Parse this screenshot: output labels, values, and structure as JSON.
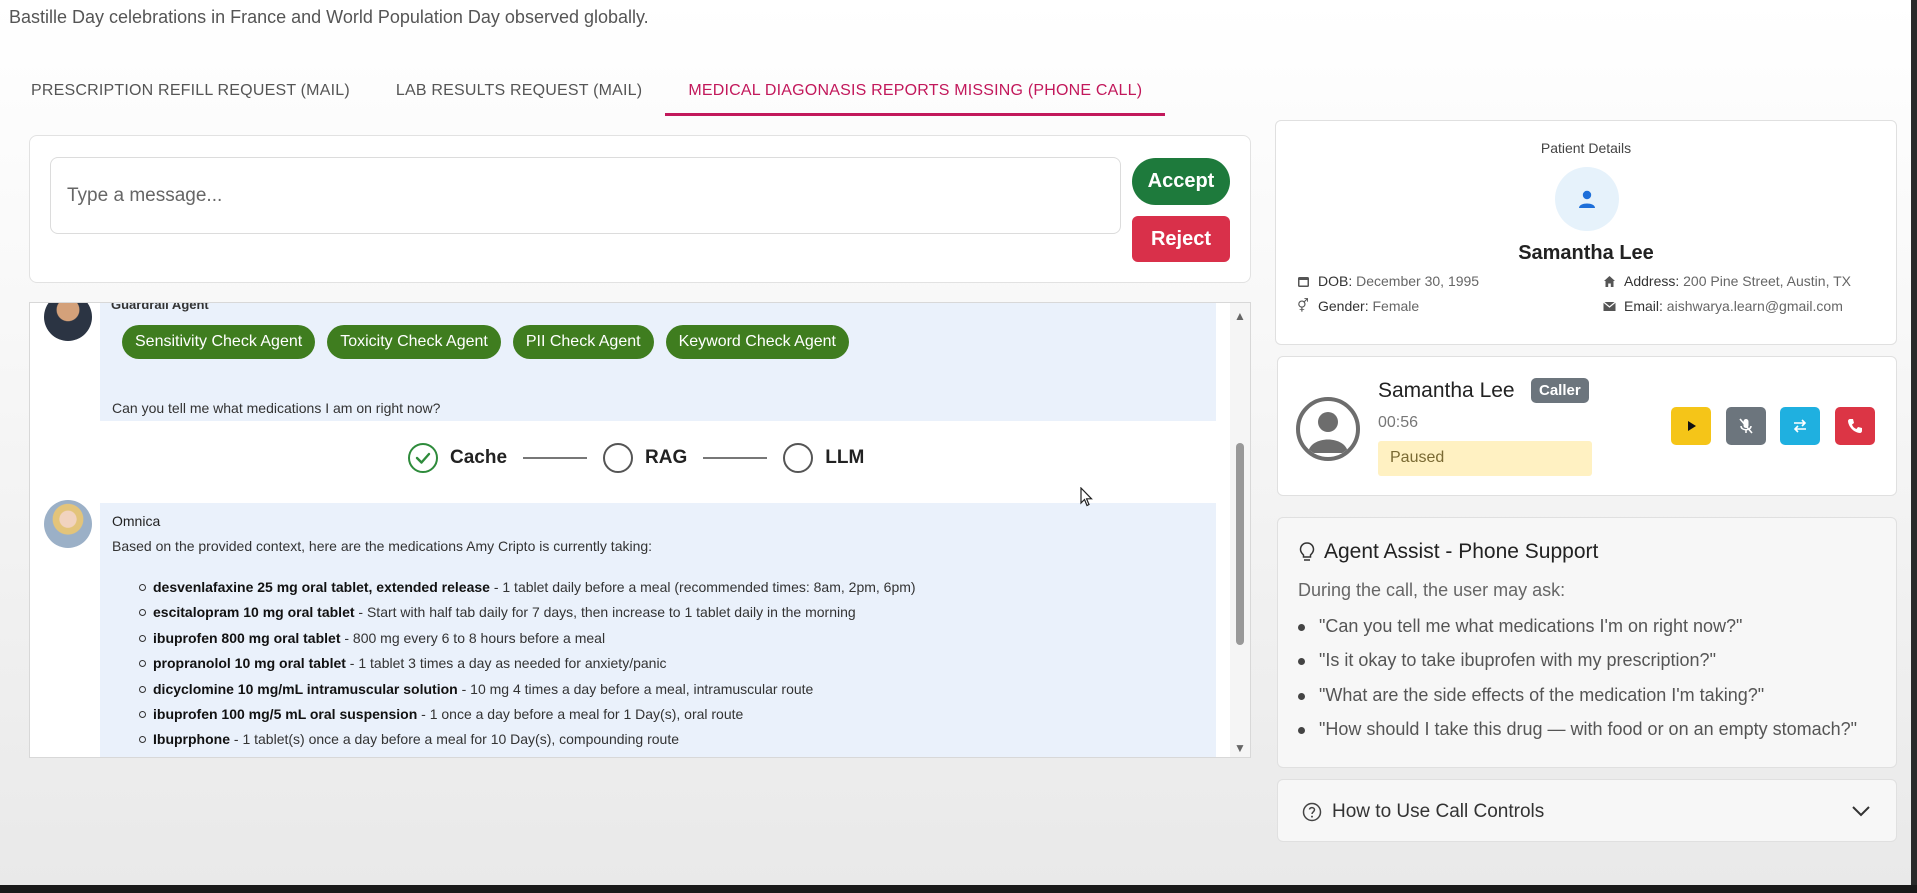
{
  "header": {
    "ticker_text": "Bastille Day celebrations in France and World Population Day observed globally."
  },
  "tabs": [
    {
      "label": "PRESCRIPTION REFILL REQUEST (MAIL)",
      "active": false
    },
    {
      "label": "LAB RESULTS REQUEST (MAIL)",
      "active": false
    },
    {
      "label": "MEDICAL DIAGONASIS REPORTS MISSING (PHONE CALL)",
      "active": true
    }
  ],
  "composer": {
    "placeholder": "Type a message...",
    "accept_label": "Accept",
    "reject_label": "Reject"
  },
  "chat": {
    "guardrail": {
      "sender_partial": "Guardrail Agent",
      "agents": [
        "Sensitivity Check Agent",
        "Toxicity Check Agent",
        "PII Check Agent",
        "Keyword Check Agent"
      ],
      "question": "Can you tell me what medications I am on right now?"
    },
    "pipeline": [
      {
        "label": "Cache",
        "done": true
      },
      {
        "label": "RAG",
        "done": false
      },
      {
        "label": "LLM",
        "done": false
      }
    ],
    "response": {
      "sender": "Omnica",
      "intro": "Based on the provided context, here are the medications Amy Cripto is currently taking:",
      "medications": [
        {
          "name": "desvenlafaxine 25 mg oral tablet, extended release",
          "detail": " - 1 tablet daily before a meal (recommended times: 8am, 2pm, 6pm)"
        },
        {
          "name": "escitalopram 10 mg oral tablet",
          "detail": " - Start with half tab daily for 7 days, then increase to 1 tablet daily in the morning"
        },
        {
          "name": "ibuprofen 800 mg oral tablet",
          "detail": " - 800 mg every 6 to 8 hours before a meal"
        },
        {
          "name": "propranolol 10 mg oral tablet",
          "detail": " - 1 tablet 3 times a day as needed for anxiety/panic"
        },
        {
          "name": "dicyclomine 10 mg/mL intramuscular solution",
          "detail": " - 10 mg 4 times a day before a meal, intramuscular route"
        },
        {
          "name": "ibuprofen 100 mg/5 mL oral suspension",
          "detail": " - 1 once a day before a meal for 1 Day(s), oral route"
        },
        {
          "name": "Ibuprphone",
          "detail": " - 1 tablet(s) once a day before a meal for 10 Day(s), compounding route"
        }
      ]
    }
  },
  "patient": {
    "title": "Patient Details",
    "name": "Samantha Lee",
    "dob_label": "DOB:",
    "dob": "December 30, 1995",
    "gender_label": "Gender:",
    "gender": "Female",
    "address_label": "Address:",
    "address": "200 Pine Street, Austin, TX",
    "email_label": "Email:",
    "email": "aishwarya.learn@gmail.com"
  },
  "caller": {
    "name": "Samantha Lee",
    "badge": "Caller",
    "timer": "00:56",
    "status": "Paused",
    "controls": [
      "play-icon",
      "mute-icon",
      "transfer-icon",
      "hangup-icon"
    ],
    "colors": {
      "play": "#f5c518",
      "mute": "#6c757d",
      "transfer": "#1fb0e0",
      "hangup": "#dc3545"
    }
  },
  "assist": {
    "title": "Agent Assist - Phone Support",
    "subtitle": "During the call, the user may ask:",
    "questions": [
      "\"Can you tell me what medications I'm on right now?\"",
      "\"Is it okay to take ibuprofen with my prescription?\"",
      "\"What are the side effects of the medication I'm taking?\"",
      "\"How should I take this drug — with food or on an empty stomach?\""
    ]
  },
  "howto": {
    "label": "How to Use Call Controls"
  }
}
